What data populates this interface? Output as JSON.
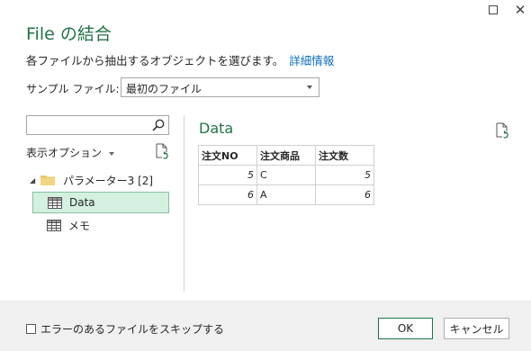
{
  "window": {
    "maximize_label": "",
    "close_label": "✕"
  },
  "title": "File の結合",
  "description": {
    "text": "各ファイルから抽出するオブジェクトを選びます。",
    "link": "詳細情報"
  },
  "sample_file": {
    "label": "サンプル ファイル:",
    "selected": "最初のファイル"
  },
  "search": {
    "value": "",
    "placeholder": ""
  },
  "display_options_label": "表示オプション",
  "tree": {
    "folder_label": "パラメーター3 [2]",
    "items": [
      {
        "label": "Data",
        "selected": true
      },
      {
        "label": "メモ",
        "selected": false
      }
    ]
  },
  "preview": {
    "title": "Data",
    "columns": [
      "注文NO",
      "注文商品",
      "注文数"
    ],
    "rows": [
      [
        "5",
        "C",
        "5"
      ],
      [
        "6",
        "A",
        "6"
      ]
    ]
  },
  "footer": {
    "skip_label": "エラーのあるファイルをスキップする",
    "ok_label": "OK",
    "cancel_label": "キャンセル"
  },
  "colors": {
    "accent": "#217346",
    "link": "#106ebe",
    "selected_bg": "#d3f0e0"
  }
}
